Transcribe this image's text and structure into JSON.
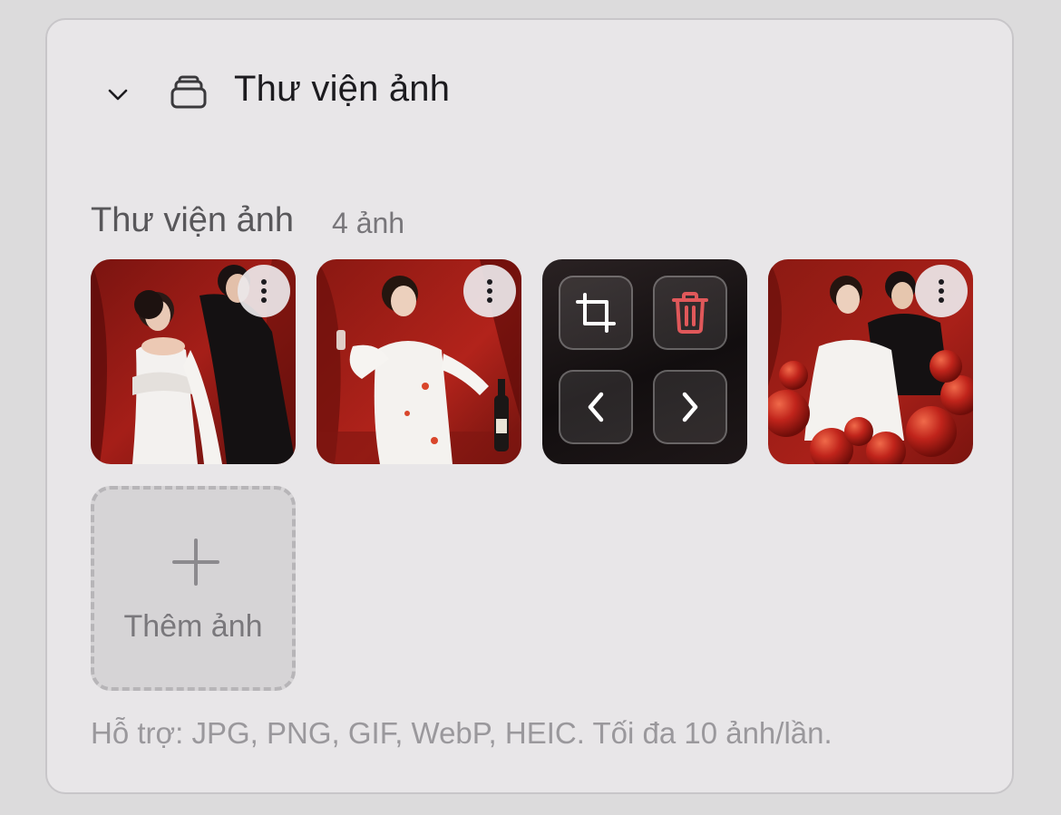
{
  "header": {
    "title": "Thư viện ảnh",
    "collapse_icon": "chevron-down-icon",
    "section_icon": "layers-icon"
  },
  "gallery": {
    "label": "Thư viện ảnh",
    "count": "4 ảnh",
    "items": [
      {
        "name": "photo-1",
        "description_icon": "more-vertical-icon"
      },
      {
        "name": "photo-2",
        "description_icon": "more-vertical-icon"
      },
      {
        "name": "photo-3-selected",
        "actions": [
          "crop-icon",
          "trash-icon",
          "chevron-left-icon",
          "chevron-right-icon"
        ]
      },
      {
        "name": "photo-4",
        "description_icon": "more-vertical-icon"
      }
    ],
    "add_label": "Thêm ảnh"
  },
  "hint": "Hỗ trợ: JPG, PNG, GIF, WebP, HEIC. Tối đa 10 ảnh/lần.",
  "colors": {
    "card_bg": "#e8e6e8",
    "delete_red": "#e0585a",
    "photo_red": "#9e1b17"
  }
}
